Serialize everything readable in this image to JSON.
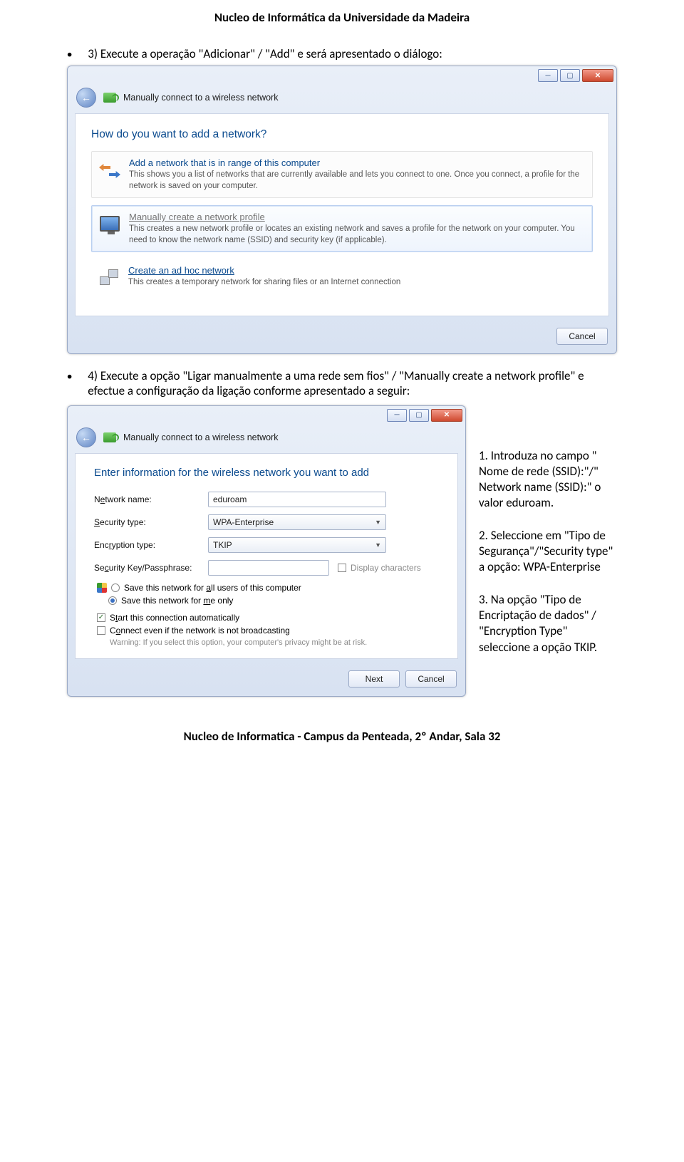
{
  "header": "Nucleo de Informática da Universidade da Madeira",
  "footer": "Nucleo de Informatica - Campus da Penteada, 2º Andar, Sala 32",
  "step3": "3) Execute a operação \"Adicionar\" / \"Add\" e será apresentado o diálogo:",
  "step4": "4) Execute a opção \"Ligar manualmente a uma rede sem fios\" / \"Manually create a network profile\" e efectue a configuração da ligação conforme apresentado a seguir:",
  "win1": {
    "shell_text": "Manually connect to a wireless network",
    "heading": "How do you want to add a network?",
    "opt1_t": "Add a network that is in range of this computer",
    "opt1_d": "This shows you a list of networks that are currently available and lets you connect to one. Once you connect, a profile for the network is saved on your computer.",
    "opt2_t": "Manually create a network profile",
    "opt2_d": "This creates a new network profile or locates an existing network and saves a profile for the network on your computer. You need to know the network name (SSID) and security key (if applicable).",
    "opt3_t": "Create an ad hoc network",
    "opt3_d": "This creates a temporary network for sharing files or an Internet connection",
    "cancel": "Cancel"
  },
  "win2": {
    "shell_text": "Manually connect to a wireless network",
    "heading": "Enter information for the wireless network you want to add",
    "l_name": "Network name:",
    "v_name": "eduroam",
    "l_sec": "Security type:",
    "v_sec": "WPA-Enterprise",
    "l_enc": "Encryption type:",
    "v_enc": "TKIP",
    "l_key": "Security Key/Passphrase:",
    "chk_display": "Display characters",
    "r_all": "Save this network for all users of this computer",
    "r_me": "Save this network for me only",
    "c_auto": "Start this connection automatically",
    "c_hidden": "Connect even if the network is not broadcasting",
    "warn": "Warning: If you select this option, your computer's privacy might be at risk.",
    "next": "Next",
    "cancel": "Cancel"
  },
  "notes": {
    "n1": "1. Introduza no campo \" Nome de rede (SSID):\"/\" Network name (SSID):\" o valor eduroam.",
    "n2": "2. Seleccione em \"Tipo de Segurança\"/\"Security type\" a opção: WPA-Enterprise",
    "n3": "3. Na opção \"Tipo de Encriptação de dados\" / \"Encryption Type\" seleccione a opção TKIP."
  }
}
